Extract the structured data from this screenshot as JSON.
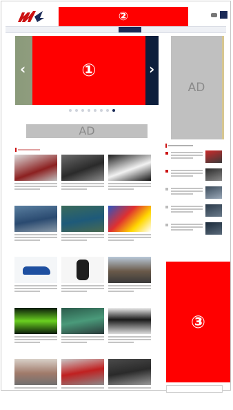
{
  "header": {
    "logo_alt": "logo",
    "banner_label": "②",
    "nav_items": [
      "",
      "",
      "",
      "",
      "",
      "",
      "",
      ""
    ]
  },
  "hero": {
    "label": "①",
    "prev_symbol": "‹",
    "next_symbol": "›",
    "dots": [
      false,
      false,
      false,
      false,
      false,
      false,
      false,
      true
    ]
  },
  "ads": {
    "right": "AD",
    "middle": "AD"
  },
  "right_block": {
    "label": "③"
  },
  "colors": {
    "accent": "#1a2a57",
    "red": "#ff0000",
    "ad_gray": "#c0c0c0"
  }
}
